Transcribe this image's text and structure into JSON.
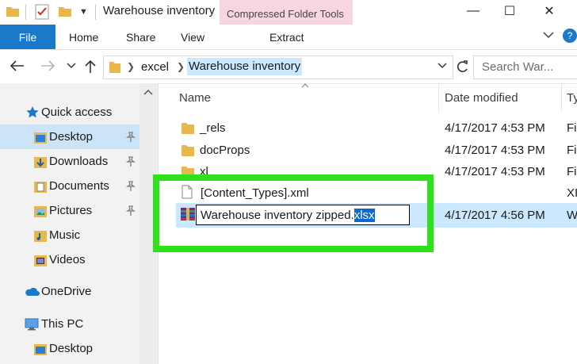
{
  "window": {
    "title": "Warehouse inventory",
    "contextual_tab_title": "Compressed Folder Tools",
    "minimize": "—",
    "maximize": "☐",
    "close": "✕"
  },
  "ribbon": {
    "file": "File",
    "tabs": [
      "Home",
      "Share",
      "View"
    ],
    "contextual_tab": "Extract"
  },
  "address": {
    "breadcrumb": [
      "excel",
      "Warehouse inventory"
    ],
    "search_placeholder": "Search War..."
  },
  "nav": {
    "items": [
      {
        "label": "Quick access",
        "icon": "star-icon",
        "pinned": false,
        "selected": false
      },
      {
        "label": "Desktop",
        "icon": "desktop-folder-icon",
        "pinned": true,
        "selected": true
      },
      {
        "label": "Downloads",
        "icon": "downloads-folder-icon",
        "pinned": true,
        "selected": false
      },
      {
        "label": "Documents",
        "icon": "documents-folder-icon",
        "pinned": true,
        "selected": false
      },
      {
        "label": "Pictures",
        "icon": "pictures-folder-icon",
        "pinned": true,
        "selected": false
      },
      {
        "label": "Music",
        "icon": "music-folder-icon",
        "pinned": false,
        "selected": false
      },
      {
        "label": "Videos",
        "icon": "videos-folder-icon",
        "pinned": false,
        "selected": false
      },
      {
        "label": "OneDrive",
        "icon": "cloud-icon",
        "pinned": false,
        "selected": false
      },
      {
        "label": "This PC",
        "icon": "computer-icon",
        "pinned": false,
        "selected": false
      },
      {
        "label": "Desktop",
        "icon": "desktop-folder-icon",
        "pinned": false,
        "selected": false
      }
    ]
  },
  "list": {
    "columns": {
      "name": "Name",
      "date": "Date modified",
      "type": "Ty"
    },
    "files": [
      {
        "name": "_rels",
        "date": "4/17/2017 4:53 PM",
        "type": "Fi",
        "kind": "folder"
      },
      {
        "name": "docProps",
        "date": "4/17/2017 4:53 PM",
        "type": "Fi",
        "kind": "folder"
      },
      {
        "name": "xl",
        "date": "4/17/2017 4:53 PM",
        "type": "Fi",
        "kind": "folder"
      },
      {
        "name": "[Content_Types].xml",
        "date": "",
        "type": "XI",
        "kind": "xml"
      },
      {
        "name": "",
        "date": "4/17/2017 4:56 PM",
        "type": "W",
        "kind": "archive"
      }
    ],
    "rename": {
      "base": "Warehouse inventory zipped.",
      "extension": "xlsx"
    }
  },
  "colors": {
    "accent": "#1979ca",
    "selection": "#cce8ff",
    "highlight_border": "#2ee21a",
    "contextual_tab": "#f7d6e2"
  }
}
